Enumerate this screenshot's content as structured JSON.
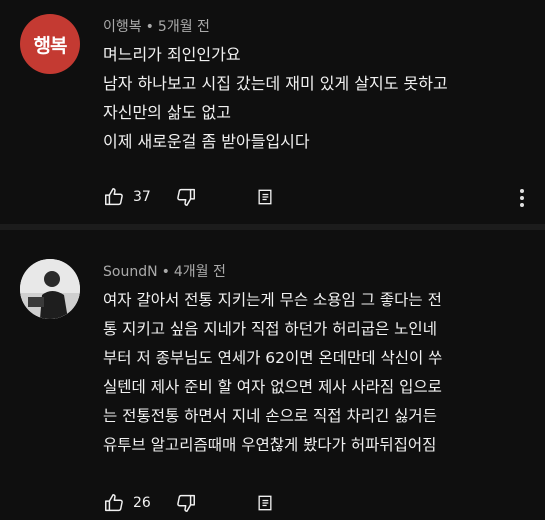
{
  "comments": [
    {
      "avatar_text": "행복",
      "author": "이행복",
      "time": "5개월 전",
      "lines": [
        "며느리가 죄인인가요",
        "남자 하나보고 시집 갔는데 재미 있게 살지도 못하고",
        "자신만의 삶도 없고",
        "이제  새로운걸 좀 받아들입시다"
      ],
      "likes": "37",
      "avatar_color": "#c43a32"
    },
    {
      "author": "SoundN",
      "time": "4개월 전",
      "lines": [
        "여자 갈아서 전통 지키는게 무슨 소용임 그 좋다는 전",
        "통 지키고 싶음 지네가 직접 하던가 허리굽은 노인네",
        "부터 저 종부님도 연세가 62이면 온데만데 삭신이 쑤",
        "실텐데 제사 준비 할 여자 없으면 제사 사라짐 입으로",
        "는 전통전통 하면서 지네 손으로 직접 차리긴 싫거든",
        "유투브 알고리즘때매 우연찮게 봤다가 허파뒤집어짐"
      ],
      "likes": "26"
    }
  ],
  "icons": {
    "like": "thumbs-up-icon",
    "dislike": "thumbs-down-icon",
    "reply": "reply-icon",
    "more": "more-vertical-icon"
  }
}
